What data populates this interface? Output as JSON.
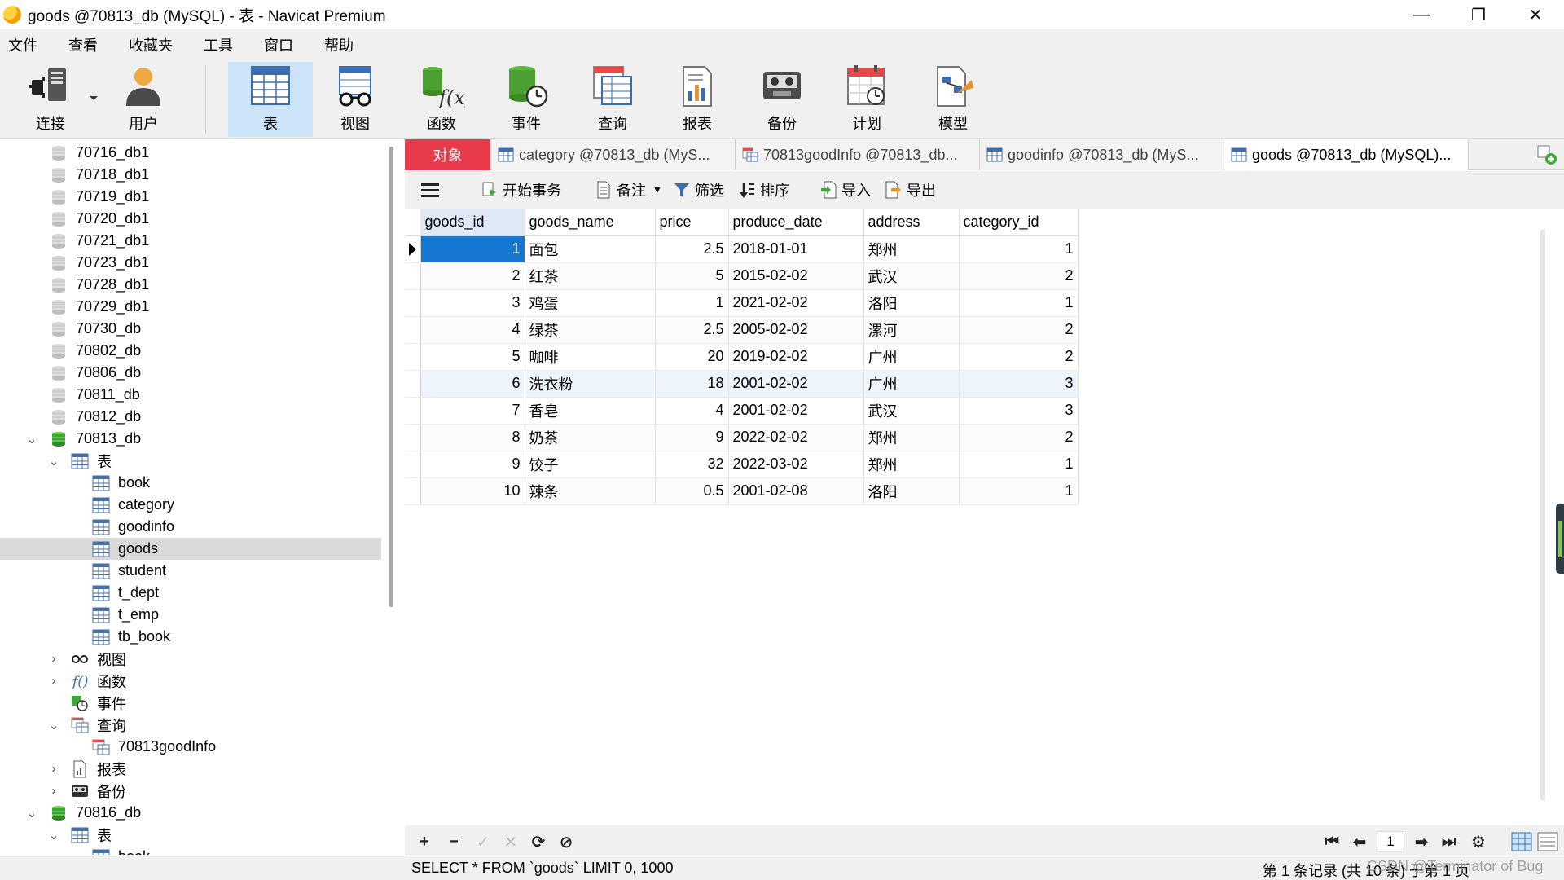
{
  "window": {
    "title": "goods @70813_db (MySQL) - 表 - Navicat Premium",
    "controls": {
      "minimize": "—",
      "restore": "❐",
      "close": "✕"
    }
  },
  "menu": [
    "文件",
    "查看",
    "收藏夹",
    "工具",
    "窗口",
    "帮助"
  ],
  "toolbar": {
    "connect": "连接",
    "user": "用户",
    "table": "表",
    "view": "视图",
    "function": "函数",
    "event": "事件",
    "query": "查询",
    "report": "报表",
    "backup": "备份",
    "schedule": "计划",
    "model": "模型"
  },
  "sidebar": {
    "databases": [
      "70716_db1",
      "70718_db1",
      "70719_db1",
      "70720_db1",
      "70721_db1",
      "70723_db1",
      "70728_db1",
      "70729_db1",
      "70730_db",
      "70802_db",
      "70806_db",
      "70811_db",
      "70812_db"
    ],
    "open_db": "70813_db",
    "tables_folder": "表",
    "tables": [
      "book",
      "category",
      "goodinfo",
      "goods",
      "student",
      "t_dept",
      "t_emp",
      "tb_book"
    ],
    "selected_table": "goods",
    "views_folder": "视图",
    "functions_folder": "函数",
    "events_folder": "事件",
    "queries_folder": "查询",
    "query_item": "70813goodInfo",
    "reports_folder": "报表",
    "backups_folder": "备份",
    "next_db": "70816_db",
    "next_tables_folder": "表",
    "next_partial": "book"
  },
  "tabs": {
    "objects": "对象",
    "tab1": "category @70813_db (MyS...",
    "tab2": "70813goodInfo @70813_db...",
    "tab3": "goodinfo @70813_db (MyS...",
    "tab4": "goods @70813_db (MySQL)..."
  },
  "object_toolbar": {
    "begin_tx": "开始事务",
    "memo": "备注",
    "filter": "筛选",
    "sort": "排序",
    "import": "导入",
    "export": "导出"
  },
  "grid": {
    "columns": [
      "goods_id",
      "goods_name",
      "price",
      "produce_date",
      "address",
      "category_id"
    ],
    "rows": [
      [
        "1",
        "面包",
        "2.5",
        "2018-01-01",
        "郑州",
        "1"
      ],
      [
        "2",
        "红茶",
        "5",
        "2015-02-02",
        "武汉",
        "2"
      ],
      [
        "3",
        "鸡蛋",
        "1",
        "2021-02-02",
        "洛阳",
        "1"
      ],
      [
        "4",
        "绿茶",
        "2.5",
        "2005-02-02",
        "漯河",
        "2"
      ],
      [
        "5",
        "咖啡",
        "20",
        "2019-02-02",
        "广州",
        "2"
      ],
      [
        "6",
        "洗衣粉",
        "18",
        "2001-02-02",
        "广州",
        "3"
      ],
      [
        "7",
        "香皂",
        "4",
        "2001-02-02",
        "武汉",
        "3"
      ],
      [
        "8",
        "奶茶",
        "9",
        "2022-02-02",
        "郑州",
        "2"
      ],
      [
        "9",
        "饺子",
        "32",
        "2022-03-02",
        "郑州",
        "1"
      ],
      [
        "10",
        "辣条",
        "0.5",
        "2001-02-08",
        "洛阳",
        "1"
      ]
    ]
  },
  "navbar": {
    "add": "+",
    "remove": "−",
    "apply": "✓",
    "cancel": "✕",
    "refresh": "⟳",
    "stop": "⊘",
    "first": "⏮",
    "prev": "⬅",
    "page": "1",
    "next": "➡",
    "last": "⏭",
    "settings": "⚙"
  },
  "status": {
    "sql": "SELECT * FROM `goods` LIMIT 0, 1000",
    "records": "第 1 条记录 (共 10 条) 于第 1 页",
    "watermark": "CSDN @Terminator of Bug"
  },
  "colors": {
    "accent_tab": "#e83a4a",
    "selection": "#1677d2",
    "toolbar_active": "#cce4f7",
    "db_icon_open": "#3aa835"
  }
}
